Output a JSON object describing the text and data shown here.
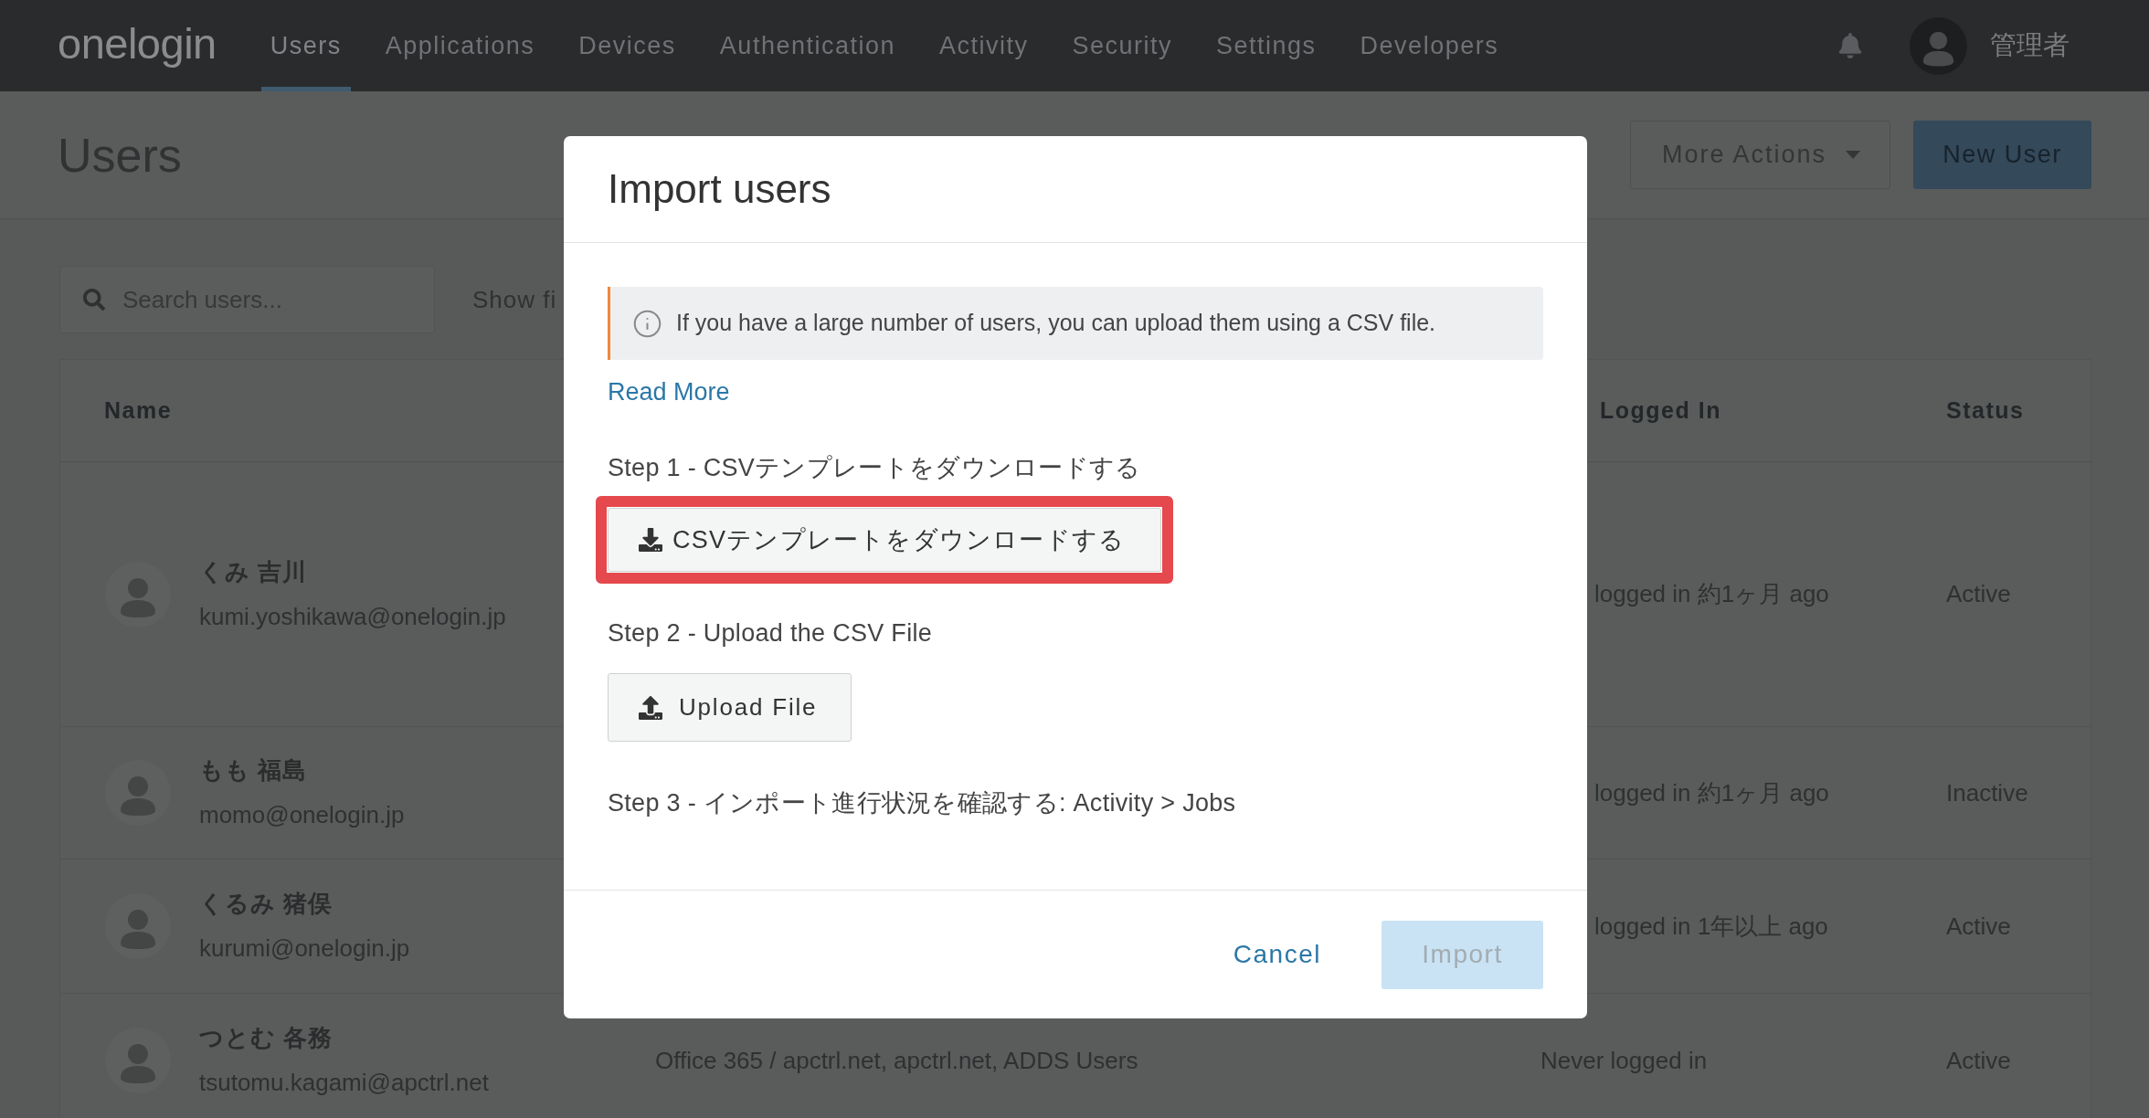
{
  "nav": {
    "logo": "onelogin",
    "items": [
      {
        "label": "Users",
        "selected": true
      },
      {
        "label": "Applications",
        "selected": false
      },
      {
        "label": "Devices",
        "selected": false
      },
      {
        "label": "Authentication",
        "selected": false
      },
      {
        "label": "Activity",
        "selected": false
      },
      {
        "label": "Security",
        "selected": false
      },
      {
        "label": "Settings",
        "selected": false
      },
      {
        "label": "Developers",
        "selected": false
      }
    ],
    "account": "管理者"
  },
  "page": {
    "title": "Users",
    "actions": [
      {
        "label": "More Actions",
        "kind": "dropdown"
      },
      {
        "label": "New User",
        "kind": "primary"
      }
    ],
    "search": {
      "placeholder": "Search users..."
    },
    "filter_link": "Show fi"
  },
  "table": {
    "columns": {
      "name": "Name",
      "last_login": "Logged In",
      "status": "Status"
    },
    "rows": [
      {
        "name": "くみ 吉川",
        "email": "kumi.yoshikawa@onelogin.jp",
        "last_login": "logged in 約1ヶ月 ago",
        "status": "Active"
      },
      {
        "name": "もも 福島",
        "email": "momo@onelogin.jp",
        "last_login": "logged in 約1ヶ月 ago",
        "status": "Inactive"
      },
      {
        "name": "くるみ 猪俣",
        "email": "kurumi@onelogin.jp",
        "last_login": "logged in 1年以上 ago",
        "status": "Active"
      },
      {
        "name": "つとむ 各務",
        "email": "tsutomu.kagami@apctrl.net",
        "applications": "Office 365 / apctrl.net, apctrl.net, ADDS Users",
        "last_login": "Never logged in",
        "status": "Active"
      }
    ]
  },
  "dialog": {
    "title": "Import users",
    "notice": "If you have a large number of users, you can upload them using a CSV file.",
    "read_more": "Read More",
    "steps": [
      {
        "kind": "download",
        "label": "Step 1 - CSVテンプレートをダウンロードする",
        "button": "CSVテンプレートをダウンロードする",
        "highlighted": true
      },
      {
        "kind": "upload",
        "label": "Step 2 - Upload the CSV File",
        "button": "Upload File",
        "highlighted": false
      },
      {
        "kind": "text",
        "label": "Step 3 - インポート進行状況を確認する: Activity > Jobs"
      }
    ],
    "buttons": [
      {
        "label": "Cancel",
        "kind": "link",
        "disabled": false
      },
      {
        "label": "Import",
        "kind": "primary",
        "disabled": true
      }
    ]
  }
}
